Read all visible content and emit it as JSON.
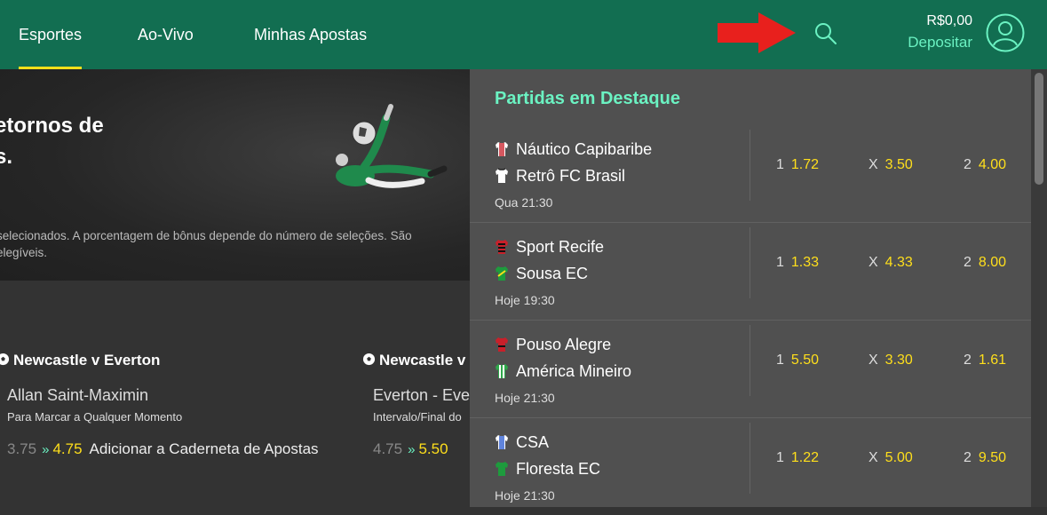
{
  "nav": {
    "items": [
      {
        "label": "Esportes",
        "active": true
      },
      {
        "label": "Ao-Vivo",
        "active": false
      },
      {
        "label": "Minhas Apostas",
        "active": false
      }
    ]
  },
  "account": {
    "balance": "R$0,00",
    "deposit_label": "Depositar"
  },
  "promo": {
    "title_line1": "etornos de",
    "title_line2": "s.",
    "text_line1": "selecionados. A porcentagem de bônus depende do número de seleções. São",
    "text_line2": "elegíveis."
  },
  "bets": [
    {
      "match": "Newcastle v Everton",
      "player": "Allan Saint-Maximin",
      "market": "Para Marcar a Qualquer Momento",
      "old_odd": "3.75",
      "new_odd": "4.75",
      "action": "Adicionar a Caderneta de Apostas"
    },
    {
      "match": "Newcastle v",
      "player": "Everton - Eve",
      "market": "Intervalo/Final do",
      "old_odd": "4.75",
      "new_odd": "5.50",
      "action": ""
    }
  ],
  "featured": {
    "title": "Partidas em Destaque",
    "matches": [
      {
        "home": "Náutico Capibaribe",
        "away": "Retrô FC Brasil",
        "time": "Qua 21:30",
        "odd1": "1.72",
        "oddx": "3.50",
        "odd2": "4.00",
        "home_color": "#c8202a",
        "away_color": "#ffffff"
      },
      {
        "home": "Sport Recife",
        "away": "Sousa EC",
        "time": "Hoje 19:30",
        "odd1": "1.33",
        "oddx": "4.33",
        "odd2": "8.00",
        "home_color": "#c8202a",
        "away_color": "#1e9b3d"
      },
      {
        "home": "Pouso Alegre",
        "away": "América Mineiro",
        "time": "Hoje 21:30",
        "odd1": "5.50",
        "oddx": "3.30",
        "odd2": "1.61",
        "home_color": "#c8202a",
        "away_color": "#2ea84a"
      },
      {
        "home": "CSA",
        "away": "Floresta EC",
        "time": "Hoje 21:30",
        "odd1": "1.22",
        "oddx": "5.00",
        "odd2": "9.50",
        "home_color": "#2a5bd0",
        "away_color": "#1e9b3d"
      }
    ],
    "labels": {
      "one": "1",
      "x": "X",
      "two": "2"
    }
  },
  "colors": {
    "header_bg": "#126e51",
    "accent_green": "#6bf2c2",
    "odds_yellow": "#ffdf1b",
    "annotation_arrow": "#e8201d"
  },
  "icons": [
    "search-icon",
    "user-avatar-icon",
    "red-arrow-annotation",
    "football-icon",
    "shirt-icon",
    "odds-boost-icon"
  ]
}
